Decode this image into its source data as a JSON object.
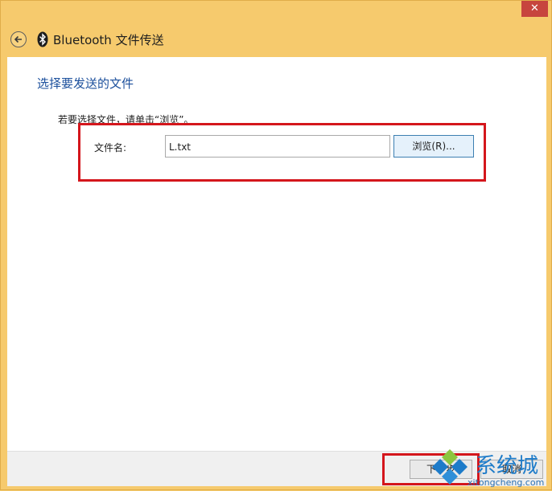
{
  "window": {
    "title": "Bluetooth 文件传送",
    "close_glyph": "✕",
    "back_icon": "back-arrow-icon",
    "app_icon": "bluetooth-icon"
  },
  "main": {
    "heading": "选择要发送的文件",
    "instruction": "若要选择文件，请单击“浏览”。",
    "file_field": {
      "label": "文件名:",
      "value": "L.txt"
    },
    "browse_button": "浏览(R)..."
  },
  "footer": {
    "next_button": "下一步",
    "cancel_button": "取消"
  },
  "watermark": {
    "text": "系统城",
    "url": "xitongcheng.com"
  },
  "colors": {
    "window_frame": "#f6ca6d",
    "heading": "#1b4f9c",
    "highlight": "#d4161c",
    "close_button": "#c7453e"
  }
}
